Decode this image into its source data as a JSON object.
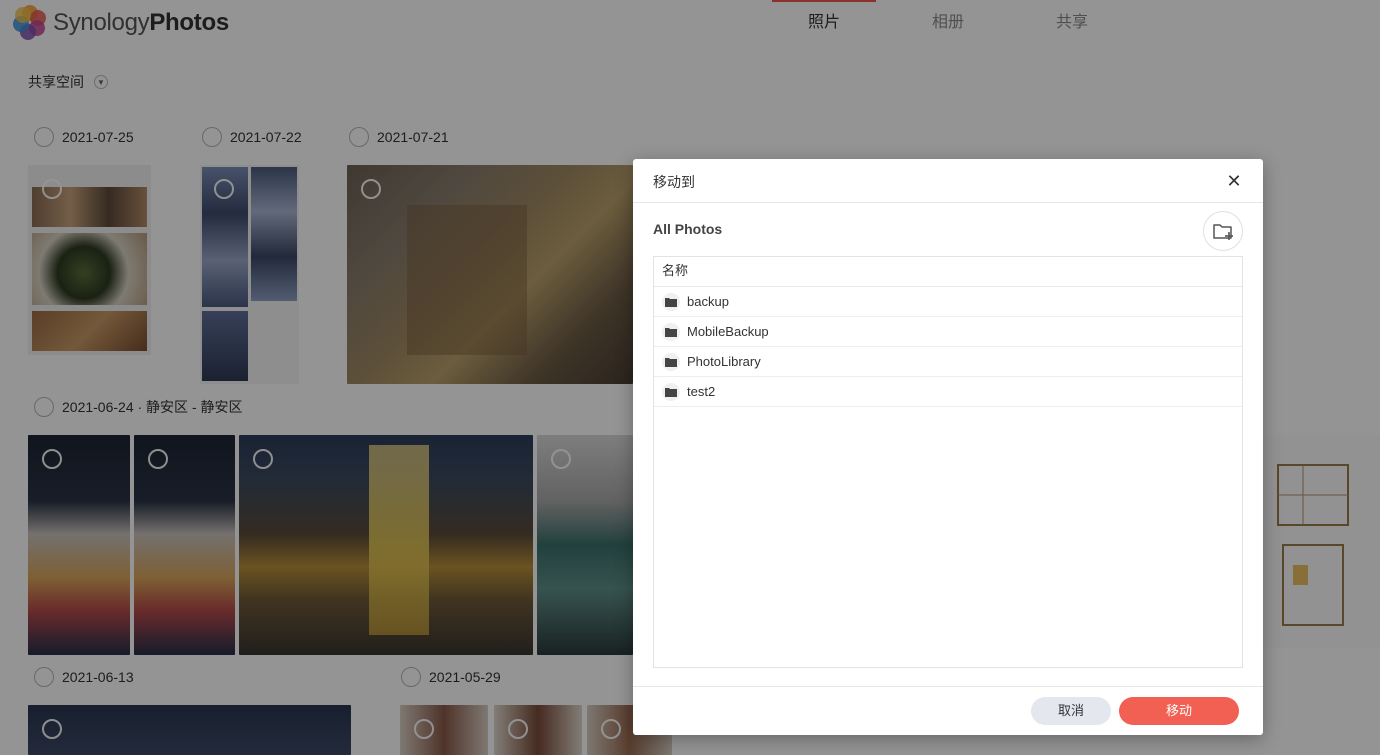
{
  "app": {
    "brand_light": "Synology",
    "brand_bold": "Photos"
  },
  "tabs": [
    {
      "label": "照片",
      "active": true
    },
    {
      "label": "相册",
      "active": false
    },
    {
      "label": "共享",
      "active": false
    }
  ],
  "space_selector": {
    "label": "共享空间"
  },
  "timeline": {
    "groups": [
      {
        "date": "2021-07-25"
      },
      {
        "date": "2021-07-22"
      },
      {
        "date": "2021-07-21"
      },
      {
        "date": "2021-06-24 · 静安区 - 静安区"
      },
      {
        "date": "2021-06-13"
      },
      {
        "date": "2021-05-29"
      }
    ]
  },
  "dialog": {
    "title": "移动到",
    "path": "All Photos",
    "column_header": "名称",
    "folders": [
      {
        "name": "backup"
      },
      {
        "name": "MobileBackup"
      },
      {
        "name": "PhotoLibrary"
      },
      {
        "name": "test2"
      }
    ],
    "cancel_label": "取消",
    "move_label": "移动"
  },
  "colors": {
    "accent": "#f25f53",
    "tab_indicator": "#e8564b",
    "cancel_button": "#e4e7ee",
    "overlay": "rgba(0,0,0,0.42)"
  },
  "icons": [
    "synology-photos-logo",
    "dropdown-caret-icon",
    "close-icon",
    "new-folder-icon",
    "folder-icon"
  ]
}
